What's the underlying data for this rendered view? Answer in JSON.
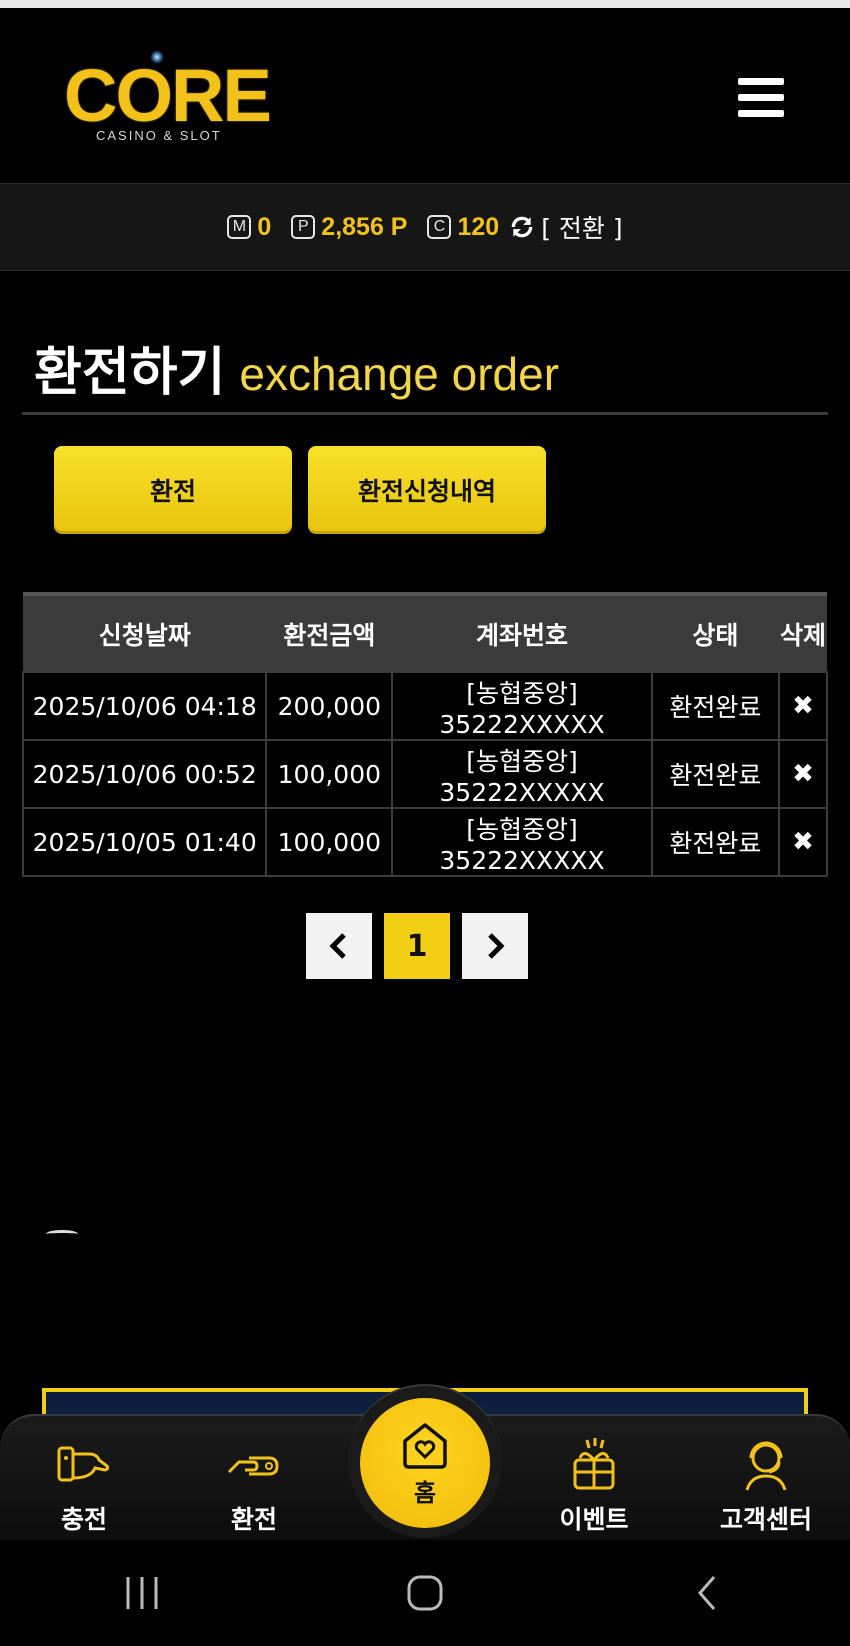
{
  "header": {
    "logo_text": "CORE",
    "logo_subtext": "CASINO & SLOT"
  },
  "balance": {
    "money_badge": "M",
    "money": "0",
    "point_badge": "P",
    "points": "2,856 P",
    "coin_badge": "C",
    "coins": "120",
    "convert_label": "[ 전환 ]"
  },
  "page": {
    "title_ko": "환전하기",
    "title_en": "exchange order"
  },
  "tabs": {
    "exchange": "환전",
    "history": "환전신청내역"
  },
  "table": {
    "headers": [
      "신청날짜",
      "환전금액",
      "계좌번호",
      "상태",
      "삭제"
    ],
    "rows": [
      {
        "date": "2025/10/06 04:18",
        "amount": "200,000",
        "account": "[농협중앙] 35222XXXXX",
        "status": "환전완료"
      },
      {
        "date": "2025/10/06 00:52",
        "amount": "100,000",
        "account": "[농협중앙] 35222XXXXX",
        "status": "환전완료"
      },
      {
        "date": "2025/10/05 01:40",
        "amount": "100,000",
        "account": "[농협중앙] 35222XXXXX",
        "status": "환전완료"
      }
    ],
    "delete_glyph": "✖"
  },
  "pagination": {
    "prev": "‹",
    "current": "1",
    "next": "›"
  },
  "bottom_nav": {
    "charge": "충전",
    "exchange": "환전",
    "home": "홈",
    "event": "이벤트",
    "support": "고객센터"
  },
  "colors": {
    "accent": "#f2c21a",
    "link": "#5a9ee6",
    "background": "#000000"
  }
}
